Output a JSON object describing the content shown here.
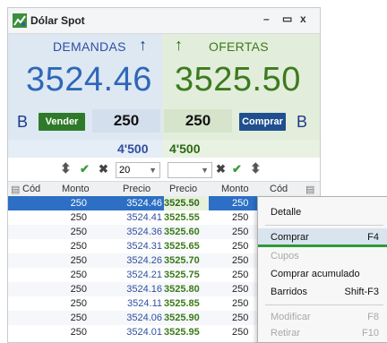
{
  "window": {
    "title": "Dólar Spot",
    "minimize": "–",
    "maximize": "▭",
    "close": "x"
  },
  "demand": {
    "label": "DEMANDAS",
    "price": "3524.46",
    "side": "B",
    "button": "Vender",
    "quantity": "250",
    "total": "4'500",
    "select_value": "20"
  },
  "offer": {
    "label": "OFERTAS",
    "price": "3525.50",
    "side": "B",
    "button": "Comprar",
    "quantity": "250",
    "total": "4'500"
  },
  "columns": {
    "cod_left": "Cód",
    "monto_left": "Monto",
    "precio_left": "Precio",
    "precio_right": "Precio",
    "monto_right": "Monto",
    "cod_right": "Cód"
  },
  "book": [
    {
      "monto_b": "250",
      "precio_b": "3524.46",
      "precio_o": "3525.50",
      "monto_o": "250"
    },
    {
      "monto_b": "250",
      "precio_b": "3524.41",
      "precio_o": "3525.55",
      "monto_o": "250"
    },
    {
      "monto_b": "250",
      "precio_b": "3524.36",
      "precio_o": "3525.60",
      "monto_o": "250"
    },
    {
      "monto_b": "250",
      "precio_b": "3524.31",
      "precio_o": "3525.65",
      "monto_o": "250"
    },
    {
      "monto_b": "250",
      "precio_b": "3524.26",
      "precio_o": "3525.70",
      "monto_o": "250"
    },
    {
      "monto_b": "250",
      "precio_b": "3524.21",
      "precio_o": "3525.75",
      "monto_o": "250"
    },
    {
      "monto_b": "250",
      "precio_b": "3524.16",
      "precio_o": "3525.80",
      "monto_o": "250"
    },
    {
      "monto_b": "250",
      "precio_b": "3524.11",
      "precio_o": "3525.85",
      "monto_o": "250"
    },
    {
      "monto_b": "250",
      "precio_b": "3524.06",
      "precio_o": "3525.90",
      "monto_o": "250"
    },
    {
      "monto_b": "250",
      "precio_b": "3524.01",
      "precio_o": "3525.95",
      "monto_o": "250"
    }
  ],
  "context_menu": {
    "detalle": "Detalle",
    "comprar": "Comprar",
    "comprar_sc": "F4",
    "cupos": "Cupos",
    "comprar_acumulado": "Comprar acumulado",
    "barridos": "Barridos",
    "barridos_sc": "Shift-F3",
    "modificar": "Modificar",
    "modificar_sc": "F8",
    "retirar": "Retirar",
    "retirar_sc": "F10"
  },
  "colors": {
    "demand_bg": "#dde8f3",
    "offer_bg": "#e2eddb",
    "demand_price": "#2f67b8",
    "offer_price": "#3c7a1e",
    "sell_button": "#2f7a2a",
    "buy_button": "#1f4f8f",
    "selected_row": "#2c6fc4"
  }
}
